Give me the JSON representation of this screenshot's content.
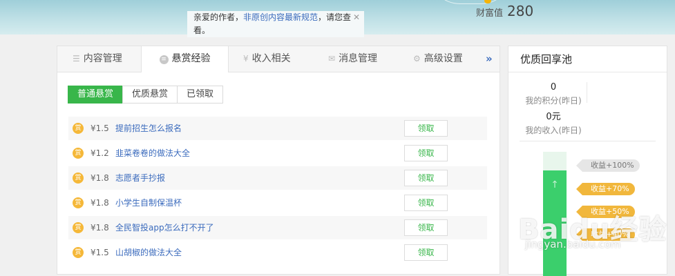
{
  "header": {
    "notice_text": "亲爱的作者，",
    "notice_link": "非原创内容最新规范",
    "notice_tail": "，请您查看。",
    "close_glyph": "✕",
    "wealth_label": "财富值",
    "wealth_value": "280"
  },
  "tabs": [
    {
      "label": "内容管理",
      "icon": "list-icon"
    },
    {
      "label": "悬赏经验",
      "icon": "coin-icon"
    },
    {
      "label": "收入相关",
      "icon": "yen-icon"
    },
    {
      "label": "消息管理",
      "icon": "mail-icon"
    },
    {
      "label": "高级设置",
      "icon": "gear-icon"
    }
  ],
  "more_glyph": "»",
  "subtabs": [
    "普通悬赏",
    "优质悬赏",
    "已领取"
  ],
  "bounties": [
    {
      "price": "¥1.5",
      "title": "提前招生怎么报名",
      "action": "领取"
    },
    {
      "price": "¥1.2",
      "title": "韭菜卷卷的做法大全",
      "action": "领取"
    },
    {
      "price": "¥1.8",
      "title": "志愿者手抄报",
      "action": "领取"
    },
    {
      "price": "¥1.8",
      "title": "小学生自制保温杯",
      "action": "领取"
    },
    {
      "price": "¥1.8",
      "title": "全民智投app怎么打不开了",
      "action": "领取"
    },
    {
      "price": "¥1.5",
      "title": "山胡椒的做法大全",
      "action": "领取"
    }
  ],
  "coin_glyph": "赏",
  "sidebar": {
    "title": "优质回享池",
    "points_value": "0",
    "points_label": "我的积分(昨日)",
    "income_value": "0元",
    "income_label": "我的收入(昨日)",
    "levels": [
      "收益+100%",
      "收益+70%",
      "收益+50%",
      "收益+40%"
    ],
    "fill_fraction": 0.85
  },
  "watermark": {
    "brand": "Baidu经验",
    "url": "jingyan.baidu.com"
  },
  "colors": {
    "accent_green": "#38b64a",
    "link_blue": "#3b6bbd",
    "coin_gold": "#f5b839"
  }
}
